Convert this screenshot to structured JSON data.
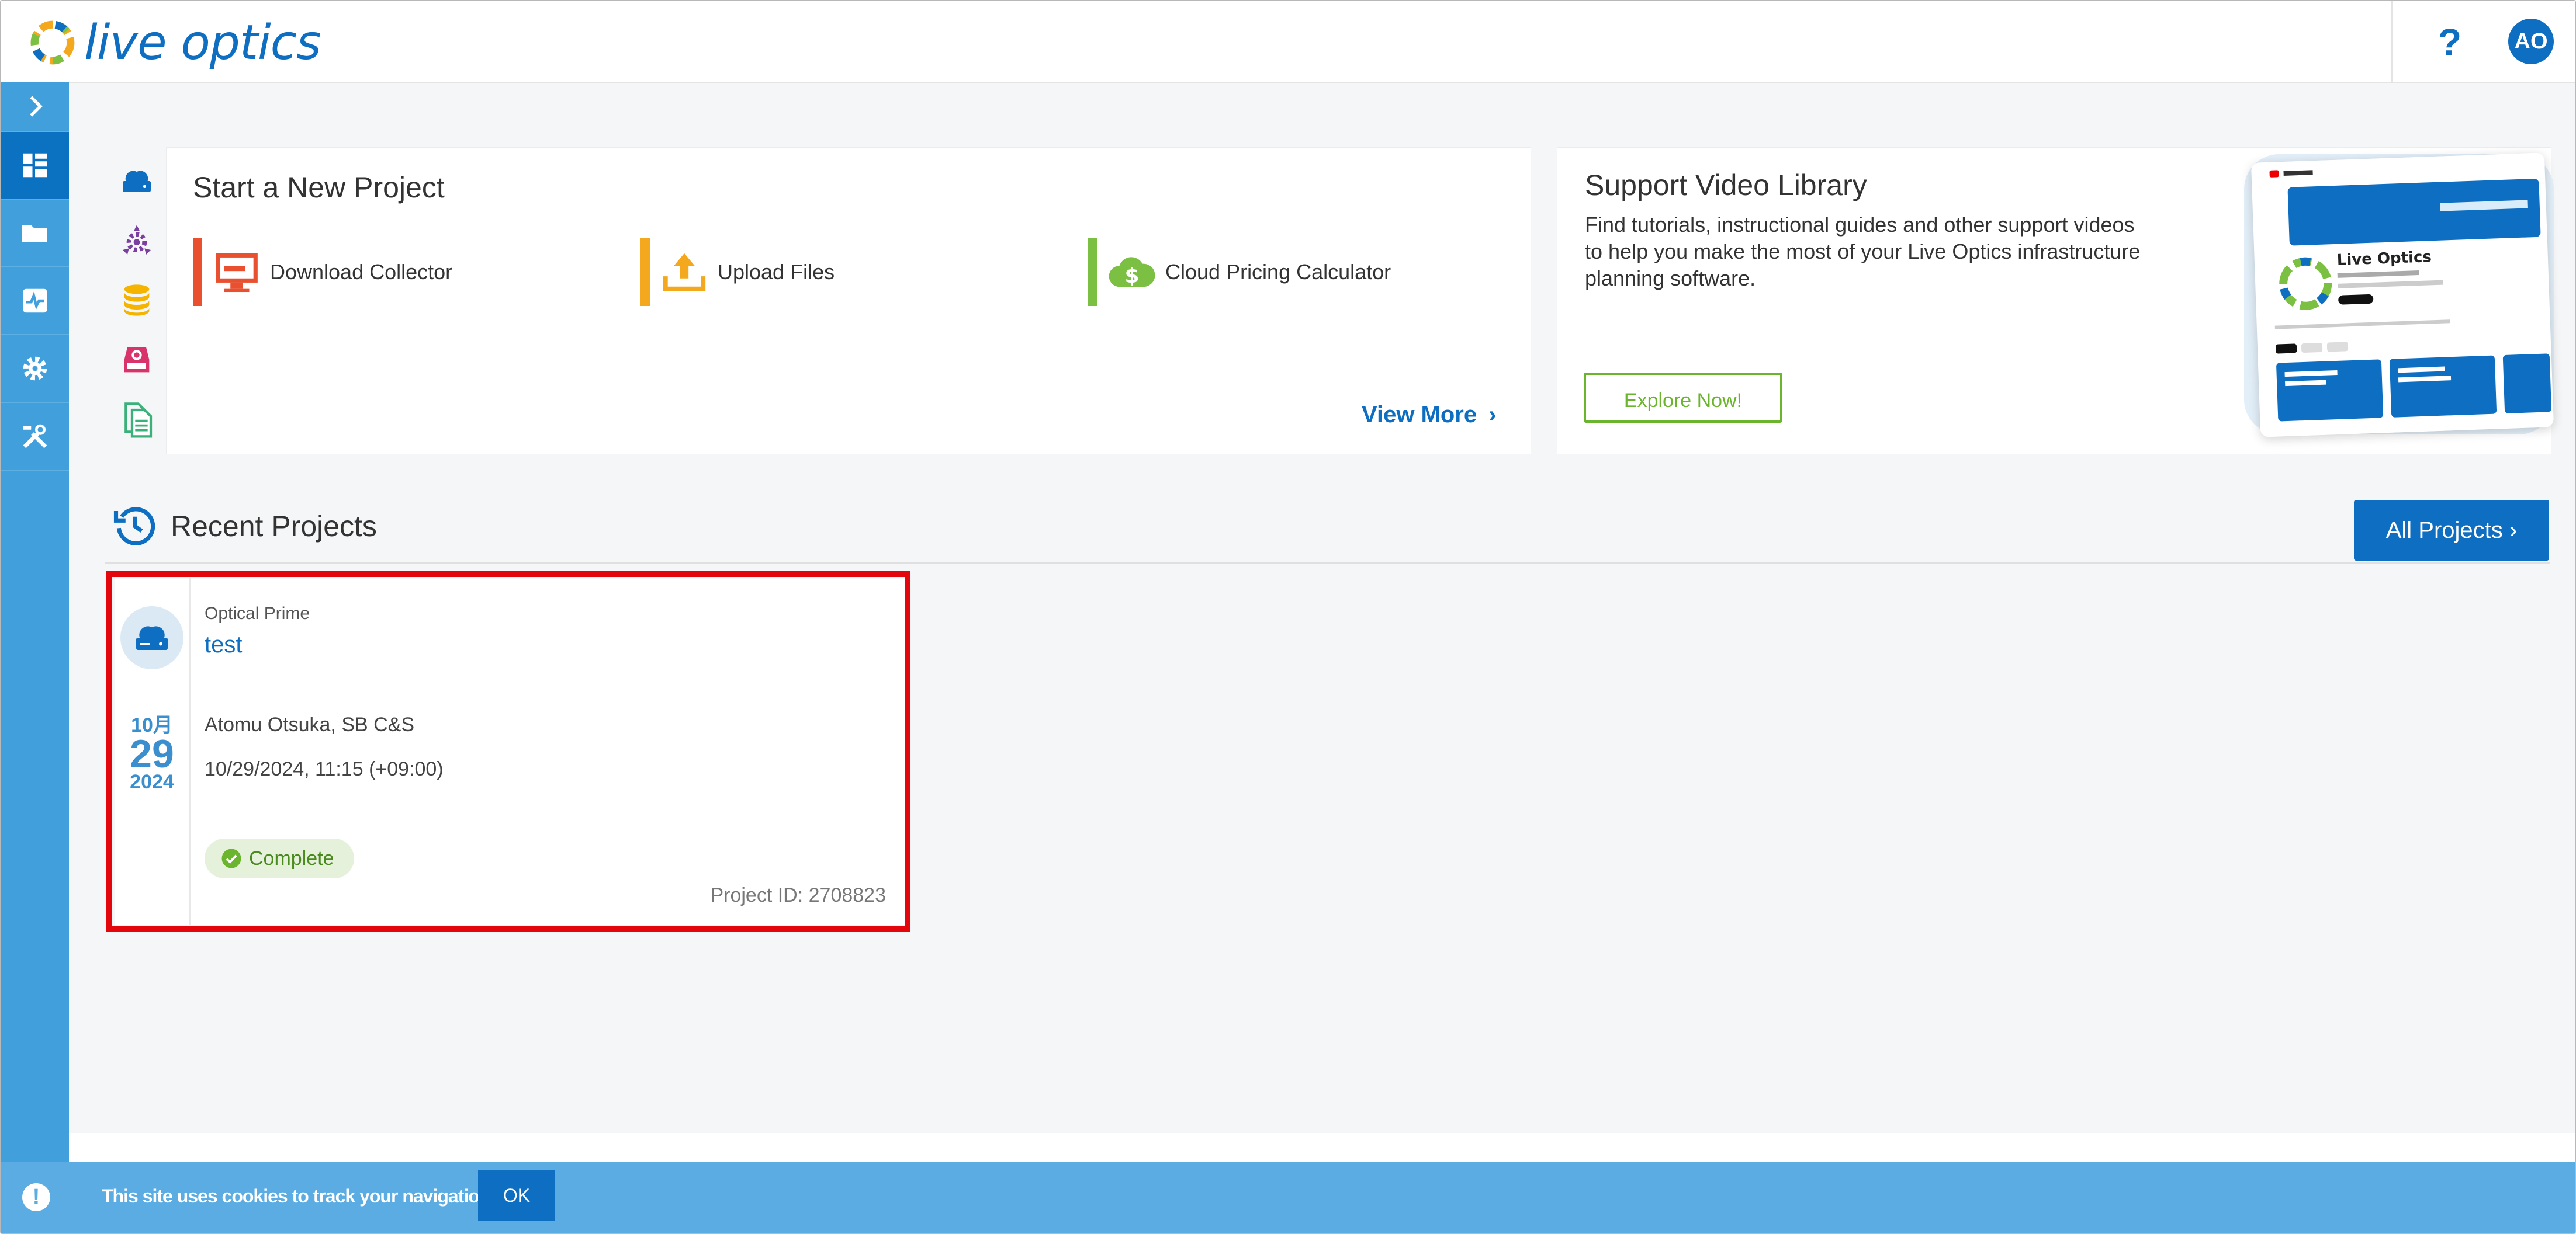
{
  "header": {
    "logo_text": "live optics",
    "help_label": "?",
    "avatar_initials": "AO"
  },
  "sidebar": {
    "items": [
      {
        "icon": "chevron-right-icon"
      },
      {
        "icon": "dashboard-icon",
        "active": true
      },
      {
        "icon": "folder-icon"
      },
      {
        "icon": "activity-icon"
      },
      {
        "icon": "gear-icon"
      },
      {
        "icon": "tools-icon"
      }
    ]
  },
  "start_project": {
    "title": "Start a New Project",
    "actions": [
      {
        "label": "Download Collector",
        "color": "#e8502f",
        "icon": "monitor-icon"
      },
      {
        "label": "Upload Files",
        "color": "#f4a81d",
        "icon": "upload-icon"
      },
      {
        "label": "Cloud Pricing Calculator",
        "color": "#7cc043",
        "icon": "cloud-dollar-icon"
      }
    ],
    "view_more": "View More"
  },
  "support": {
    "title": "Support Video Library",
    "description": "Find tutorials, instructional guides and other support videos to help you make the most of your Live Optics infrastructure planning software.",
    "button": "Explore Now!",
    "thumbnail_channel": "Live Optics"
  },
  "recent": {
    "title": "Recent Projects",
    "all_projects": "All Projects",
    "projects": [
      {
        "type": "Optical Prime",
        "name": "test",
        "month": "10月",
        "day": "29",
        "year": "2024",
        "owner": "Atomu Otsuka, SB C&S",
        "timestamp": "10/29/2024, 11:15 (+09:00)",
        "status": "Complete",
        "project_id": "Project ID: 2708823"
      }
    ]
  },
  "cookie": {
    "message": "This site uses cookies to track your navigation.",
    "ok": "OK"
  },
  "colors": {
    "brand": "#0d6ec2",
    "sidebar": "#41a0dc",
    "highlight": "#e3070d"
  }
}
